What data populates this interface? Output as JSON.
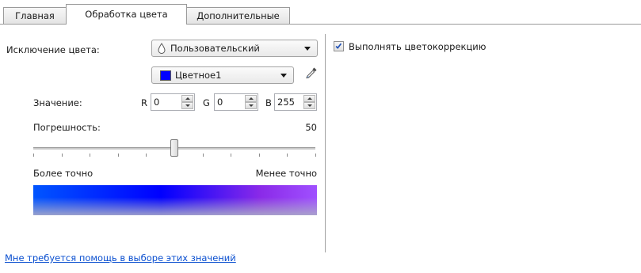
{
  "tabs": [
    {
      "label": "Главная",
      "active": false
    },
    {
      "label": "Обработка цвета",
      "active": true
    },
    {
      "label": "Дополнительные",
      "active": false
    }
  ],
  "color_exclusion": {
    "label": "Исключение цвета:",
    "mode_value": "Пользовательский",
    "color_value": "Цветное1",
    "swatch_color": "#0000ff"
  },
  "values": {
    "label": "Значение:",
    "r_label": "R",
    "r_value": "0",
    "g_label": "G",
    "g_value": "0",
    "b_label": "B",
    "b_value": "255"
  },
  "tolerance": {
    "label": "Погрешность:",
    "value": "50",
    "slider_value": 50,
    "slider_min": 0,
    "slider_max": 100,
    "more_precise_label": "Более точно",
    "less_precise_label": "Менее точно"
  },
  "color_correction": {
    "label": "Выполнять цветокоррекцию",
    "checked": true
  },
  "help_link": "Мне требуется помощь в выборе этих значений",
  "colors": {
    "link": "#0a4fd0",
    "checkmark": "#1e4fb6",
    "gradient_start": "#0055ff",
    "gradient_mid": "#0000ff",
    "gradient_end": "#a050ff"
  }
}
